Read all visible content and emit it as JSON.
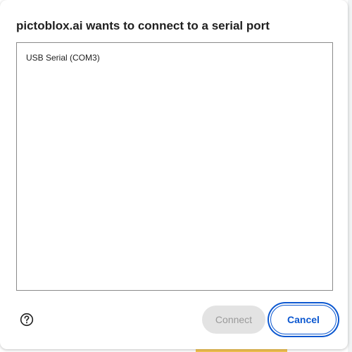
{
  "dialog": {
    "title": "pictoblox.ai wants to connect to a serial port",
    "ports": [
      {
        "label": "USB Serial (COM3)"
      }
    ],
    "help_icon": "help-circle-icon",
    "buttons": {
      "connect_label": "Connect",
      "cancel_label": "Cancel"
    }
  },
  "colors": {
    "accent": "#0b57d0",
    "disabled_bg": "#e3e3e3",
    "disabled_text": "#9a9a9a",
    "list_border": "#8a8a8a"
  }
}
